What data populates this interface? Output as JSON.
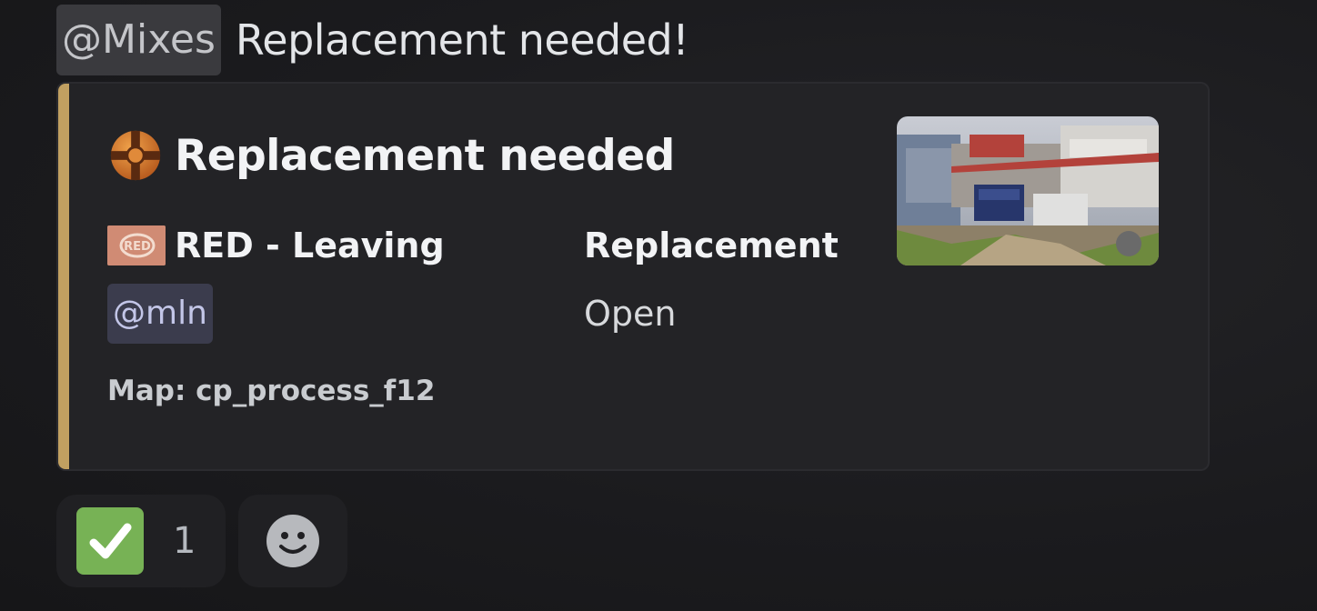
{
  "message": {
    "role_mention": "@Mixes",
    "text": "Replacement needed!"
  },
  "embed": {
    "accent_color": "#c1a061",
    "title": "Replacement needed",
    "title_icon": "tf2-logo-icon",
    "fields": [
      {
        "name": "RED - Leaving",
        "icon": "red-team-icon",
        "value": "@mln"
      },
      {
        "name": "Replacement",
        "value": "Open"
      }
    ],
    "footer": "Map: cp_process_f12",
    "thumbnail": "map-thumbnail"
  },
  "reactions": [
    {
      "emoji": "white-check-mark-icon",
      "count": "1"
    },
    {
      "emoji": "add-reaction-icon"
    }
  ]
}
